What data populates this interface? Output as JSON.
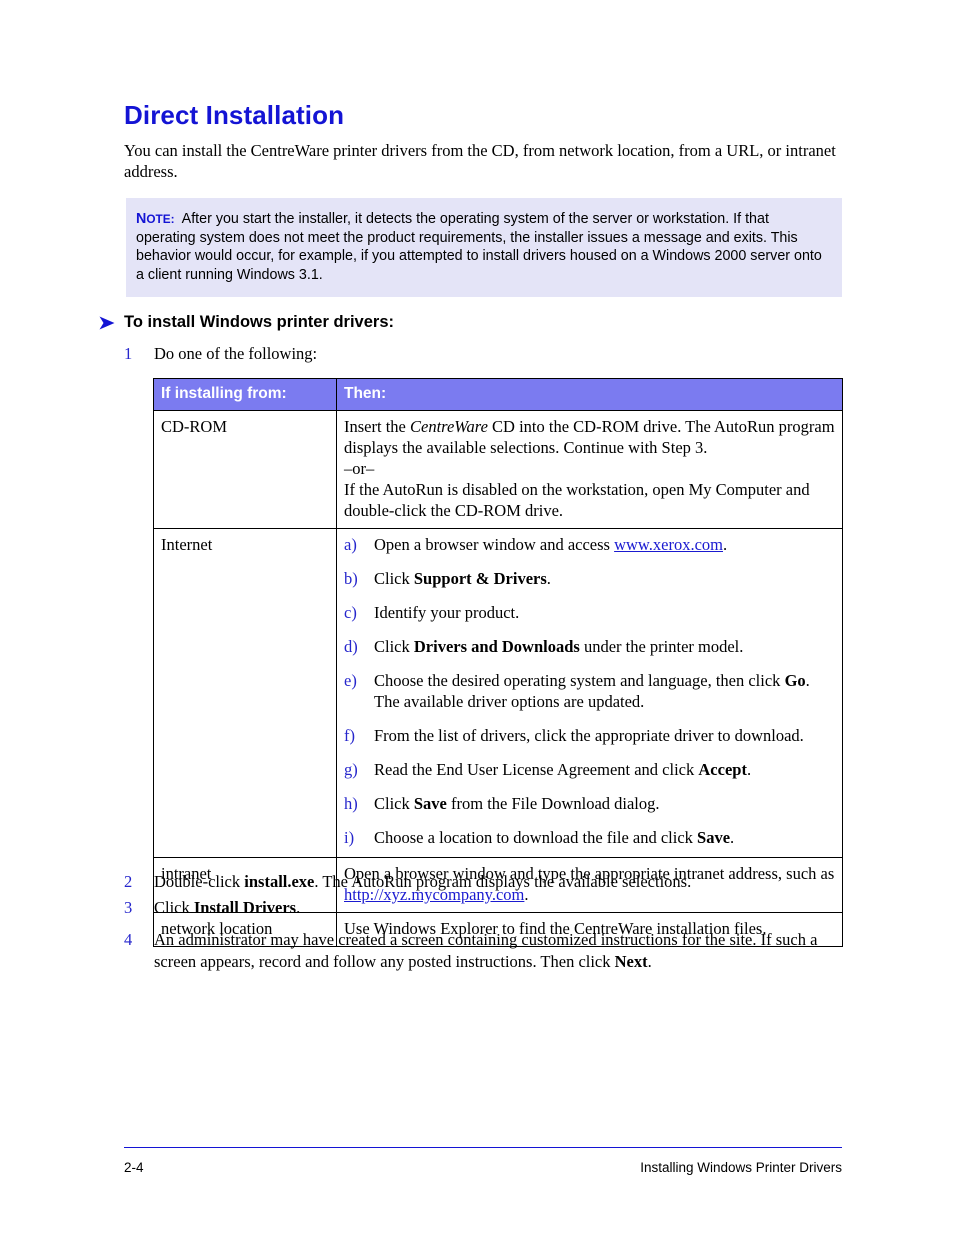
{
  "heading": "Direct Installation",
  "intro": "You can install the CentreWare printer drivers from the CD, from network location, from a URL, or intranet address.",
  "note": {
    "label_cap": "N",
    "label_rest": "OTE:",
    "text": "After you start the installer, it detects the operating system of the server or workstation. If that operating system does not meet the product requirements, the installer issues a message and exits. This behavior would occur, for example, if you attempted to install drivers housed on a Windows 2000 server onto a client running Windows 3.1."
  },
  "procedure_heading": "To install Windows printer drivers:",
  "steps": {
    "one": {
      "num": "1",
      "text": "Do one of the following:"
    },
    "two": {
      "num": "2",
      "pre": "Double-click ",
      "bold": "install.exe",
      "post": ". The AutoRun program displays the available selections."
    },
    "three": {
      "num": "3",
      "pre": "Click ",
      "bold": "Install Drivers",
      "post": "."
    },
    "four": {
      "num": "4",
      "pre": "An administrator may have created a screen containing customized instructions for the site. If such a screen appears, record and follow any posted instructions. Then click ",
      "bold": "Next",
      "post": "."
    }
  },
  "table": {
    "headers": [
      "If installing from:",
      "Then:"
    ],
    "rows": {
      "cdrom": {
        "label": "CD-ROM",
        "line1_pre": "Insert the ",
        "line1_italic": "CentreWare",
        "line1_post": " CD into the CD-ROM drive. The AutoRun program displays the available selections. Continue with Step 3.",
        "or": "–or–",
        "line2": "If the AutoRun is disabled on the workstation, open My Computer and double-click the CD-ROM drive."
      },
      "internet": {
        "label": "Internet",
        "items": [
          {
            "marker": "a)",
            "pre": "Open a browser window and access ",
            "link": "www.xerox.com",
            "post": "."
          },
          {
            "marker": "b)",
            "pre": "Click ",
            "bold": "Support & Drivers",
            "post": "."
          },
          {
            "marker": "c)",
            "pre": "Identify your product.",
            "post": ""
          },
          {
            "marker": "d)",
            "pre": "Click ",
            "bold": "Drivers and Downloads",
            "post": " under the printer model."
          },
          {
            "marker": "e)",
            "pre": "Choose the desired operating system and language, then click ",
            "bold": "Go",
            "post": ". The available driver options are updated."
          },
          {
            "marker": "f)",
            "pre": "From the list of drivers, click the appropriate driver to download.",
            "post": ""
          },
          {
            "marker": "g)",
            "pre": "Read the End User License Agreement and click ",
            "bold": "Accept",
            "post": "."
          },
          {
            "marker": "h)",
            "pre": "Click ",
            "bold": "Save",
            "post": " from the File Download dialog."
          },
          {
            "marker": "i)",
            "pre": "Choose a location to download the file and click ",
            "bold": "Save",
            "post": "."
          }
        ]
      },
      "intranet": {
        "label": "intranet",
        "pre": "Open a browser window and type the appropriate intranet address, such as ",
        "link": "http://xyz.mycompany.com",
        "post": "."
      },
      "network": {
        "label": "network location",
        "text": "Use Windows Explorer to find the CentreWare installation files."
      }
    }
  },
  "footer": {
    "page_number": "2-4",
    "chapter": "Installing Windows Printer Drivers"
  },
  "colors": {
    "heading_blue": "#1414d4",
    "table_header_bg": "#7b7bf0",
    "note_bg": "#e4e4f7",
    "link_blue": "#1a1ad0",
    "marker_blue": "#2626cc"
  }
}
